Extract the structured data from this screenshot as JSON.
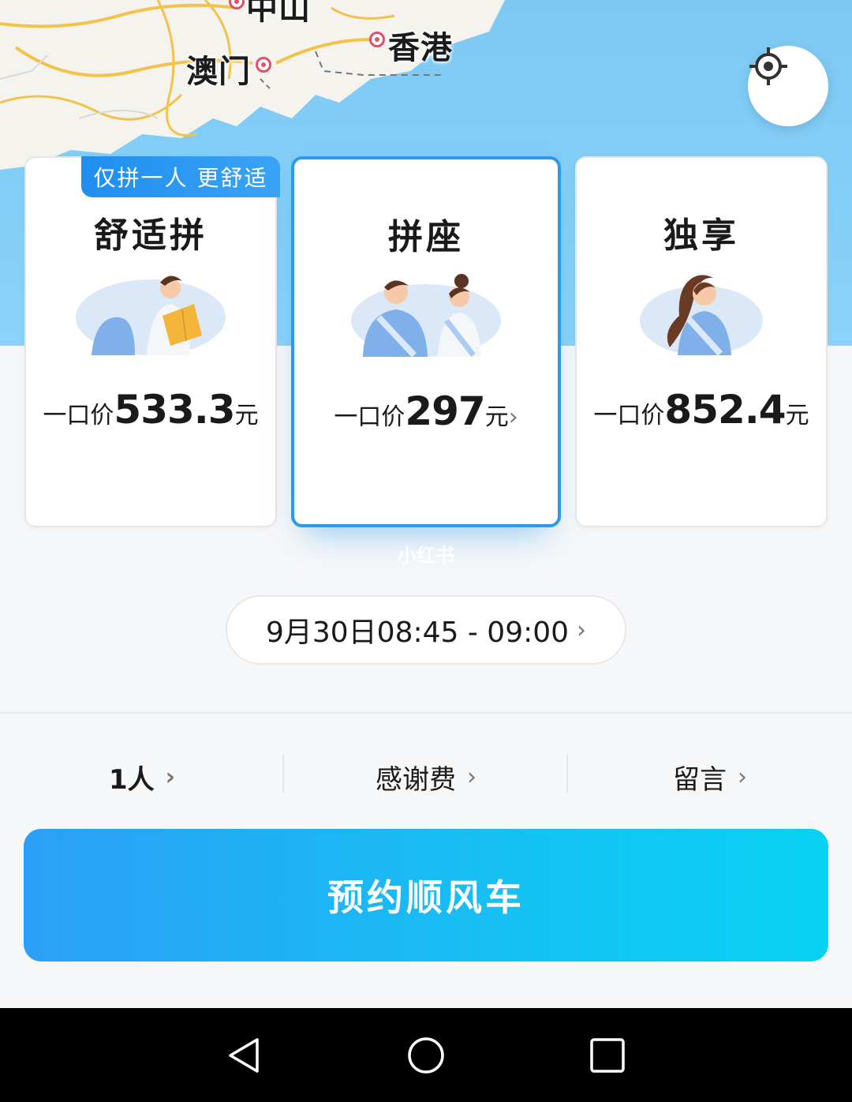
{
  "map": {
    "labels": {
      "zhongshan": "中山",
      "macau": "澳门",
      "hongkong": "香港"
    },
    "locate_icon": "crosshair-icon"
  },
  "ride_options": [
    {
      "badge": "仅拼一人 更舒适",
      "title": "舒适拼",
      "price_prefix": "一口价",
      "price": "533.3",
      "unit": "元",
      "selected": false
    },
    {
      "title": "拼座",
      "price_prefix": "一口价",
      "price": "297",
      "unit": "元",
      "chevron": "›",
      "selected": true
    },
    {
      "title": "独享",
      "price_prefix": "一口价",
      "price": "852.4",
      "unit": "元",
      "selected": false
    }
  ],
  "watermark": "小红书",
  "time_window": {
    "text": "9月30日08:45 - 09:00",
    "chevron": "›"
  },
  "options_bar": {
    "passengers": "1人",
    "thanks_fee": "感谢费",
    "message": "留言",
    "chevron": "›"
  },
  "book_button": "预约顺风车",
  "system_nav": [
    "back-icon",
    "home-icon",
    "recents-icon"
  ],
  "colors": {
    "accent": "#2a9af0",
    "button_start": "#2ba0f6",
    "button_end": "#08d2f2",
    "map_water": "#8ad3f9",
    "pin": "#e0506a"
  }
}
